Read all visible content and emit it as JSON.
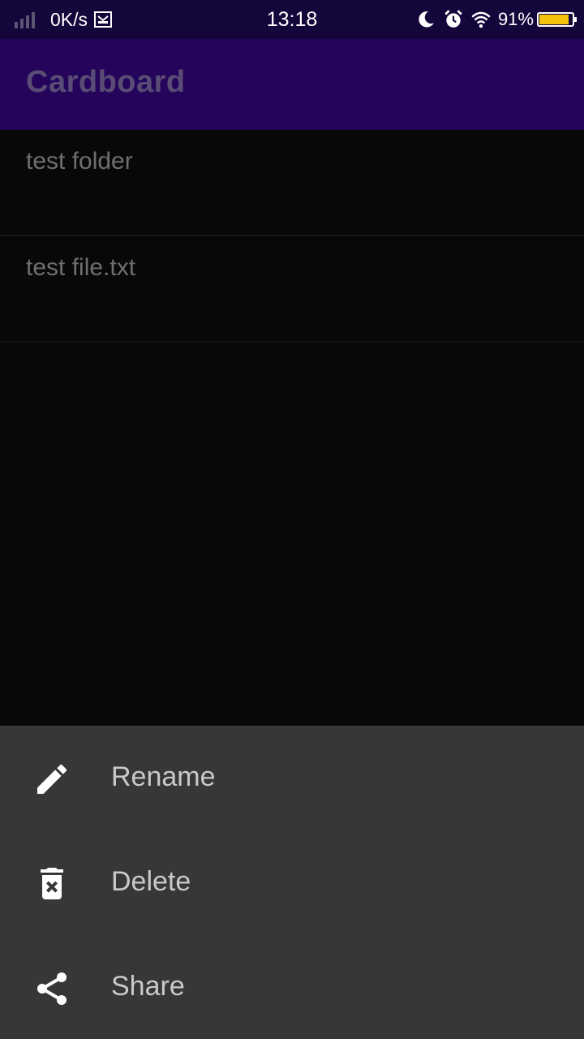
{
  "status_bar": {
    "net_speed": "0K/s",
    "time": "13:18",
    "battery_percent": "91%",
    "battery_level": 0.91,
    "icons": [
      "signal-icon",
      "mail-notification-icon",
      "moon-icon",
      "alarm-icon",
      "wifi-icon",
      "battery-icon"
    ]
  },
  "app_bar": {
    "title": "Cardboard"
  },
  "files": [
    {
      "label": "test folder"
    },
    {
      "label": "test file.txt"
    }
  ],
  "bottom_sheet": {
    "items": [
      {
        "label": "Rename",
        "icon": "pencil-icon"
      },
      {
        "label": "Delete",
        "icon": "trash-icon"
      },
      {
        "label": "Share",
        "icon": "share-icon"
      }
    ]
  },
  "colors": {
    "status_bar": "#14063a",
    "app_bar": "#25045b",
    "background": "#080808",
    "sheet": "#373737",
    "battery_fill": "#f4c20d"
  }
}
